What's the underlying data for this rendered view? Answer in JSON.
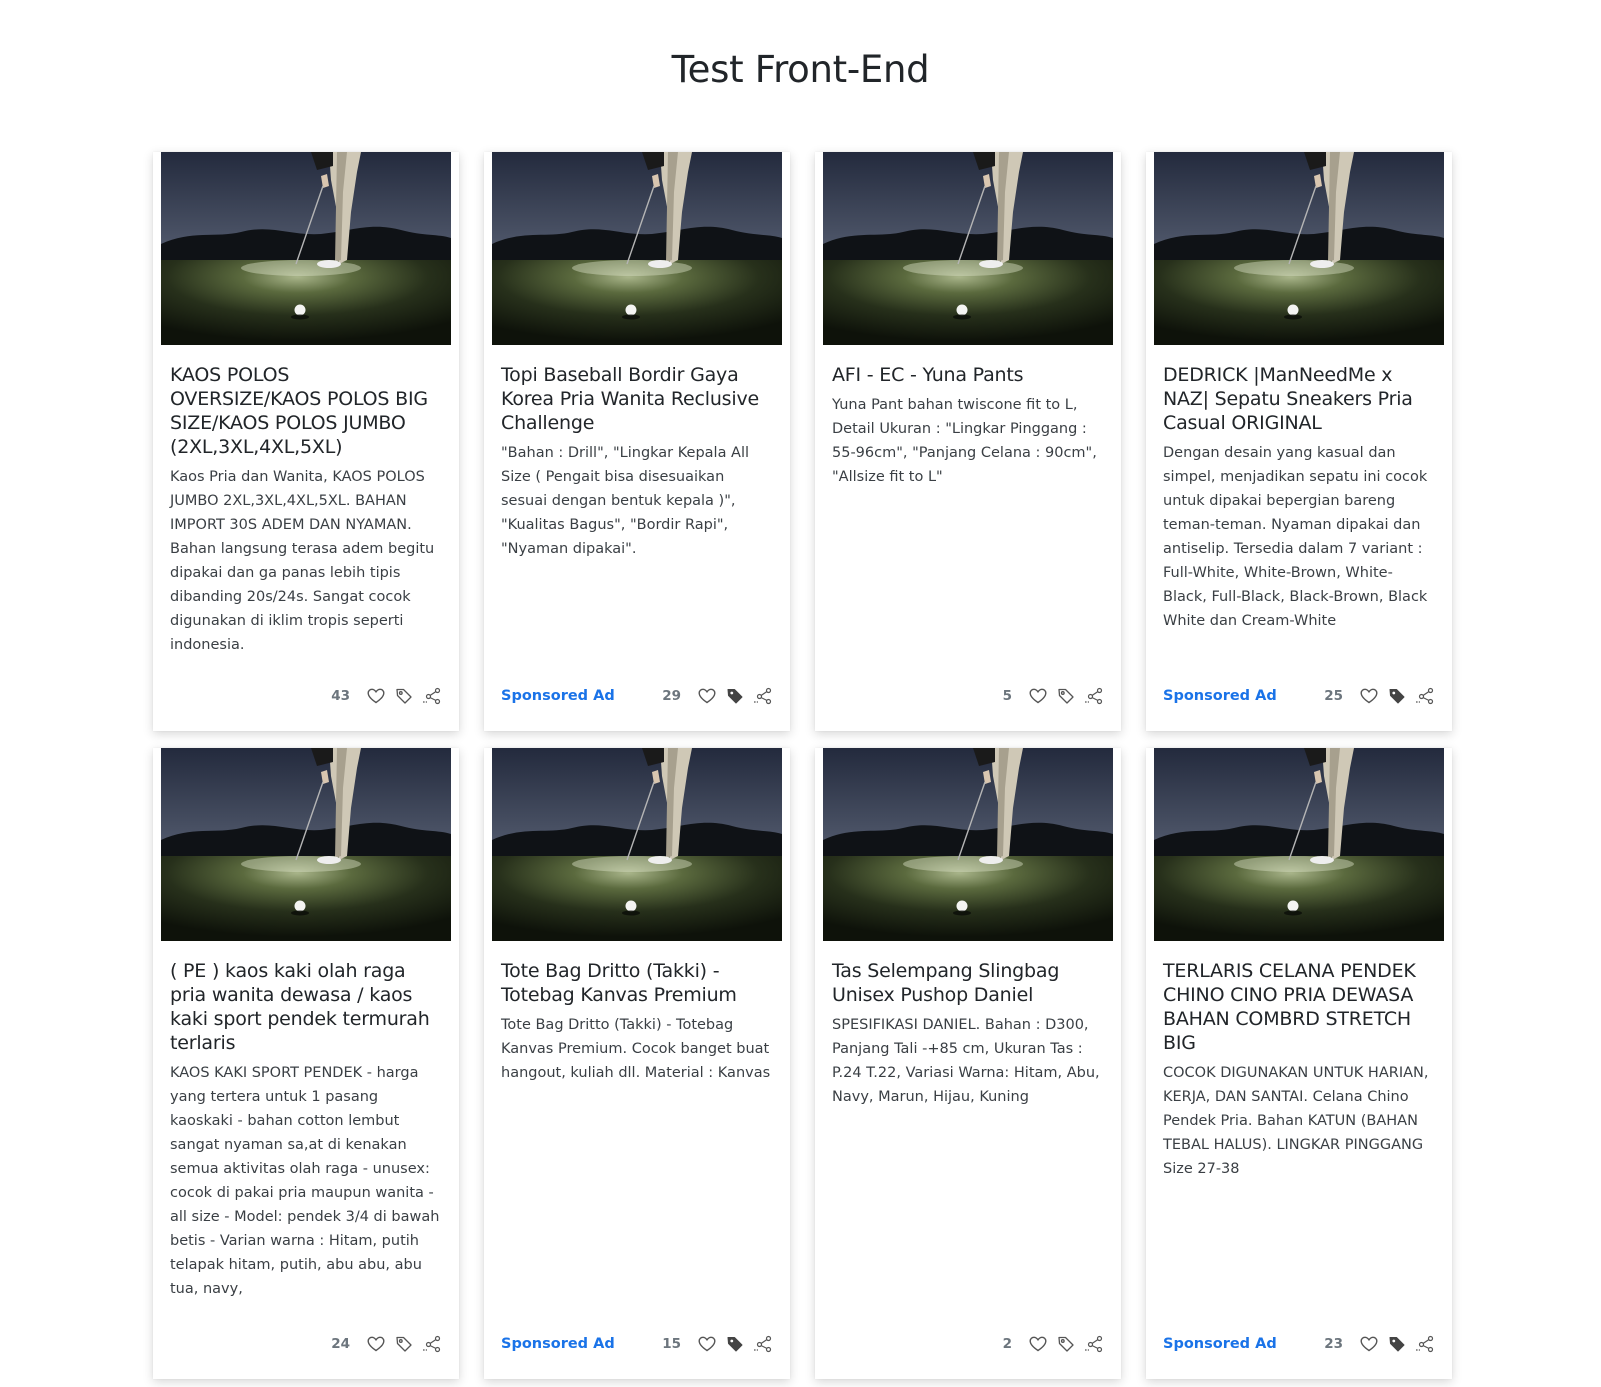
{
  "page": {
    "title": "Test Front-End"
  },
  "products": [
    {
      "title": "KAOS POLOS OVERSIZE/KAOS POLOS BIG SIZE/KAOS POLOS JUMBO (2XL,3XL,4XL,5XL)",
      "description": "Kaos Pria dan Wanita, KAOS POLOS JUMBO 2XL,3XL,4XL,5XL. BAHAN IMPORT 30S ADEM DAN NYAMAN. Bahan langsung terasa adem begitu dipakai dan ga panas lebih tipis dibanding 20s/24s. Sangat cocok digunakan di iklim tropis seperti indonesia.",
      "sponsored": "",
      "likes": "43",
      "tag_filled": false
    },
    {
      "title": "Topi Baseball Bordir Gaya Korea Pria Wanita Reclusive Challenge",
      "description": "\"Bahan : Drill\", \"Lingkar Kepala All Size ( Pengait bisa disesuaikan sesuai dengan bentuk kepala )\", \"Kualitas Bagus\", \"Bordir Rapi\", \"Nyaman dipakai\".",
      "sponsored": "Sponsored Ad",
      "likes": "29",
      "tag_filled": true
    },
    {
      "title": "AFI - EC - Yuna Pants",
      "description": "Yuna Pant bahan twiscone fit to L, Detail Ukuran : \"Lingkar Pinggang : 55-96cm\", \"Panjang Celana : 90cm\", \"Allsize fit to L\"",
      "sponsored": "",
      "likes": "5",
      "tag_filled": false
    },
    {
      "title": "DEDRICK |ManNeedMe x NAZ| Sepatu Sneakers Pria Casual ORIGINAL",
      "description": "Dengan desain yang kasual dan simpel, menjadikan sepatu ini cocok untuk dipakai bepergian bareng teman-teman. Nyaman dipakai dan antiselip. Tersedia dalam 7 variant : Full-White, White-Brown, White-Black, Full-Black, Black-Brown, Black White dan Cream-White",
      "sponsored": "Sponsored Ad",
      "likes": "25",
      "tag_filled": true
    },
    {
      "title": "( PE ) kaos kaki olah raga pria wanita dewasa / kaos kaki sport pendek termurah terlaris",
      "description": "KAOS KAKI SPORT PENDEK - harga yang tertera untuk 1 pasang kaoskaki - bahan cotton lembut sangat nyaman sa,at di kenakan semua aktivitas olah raga - unusex: cocok di pakai pria maupun wanita - all size - Model: pendek 3/4 di bawah betis - Varian warna : Hitam, putih telapak hitam, putih, abu abu, abu tua, navy,",
      "sponsored": "",
      "likes": "24",
      "tag_filled": false
    },
    {
      "title": "Tote Bag Dritto (Takki) - Totebag Kanvas Premium",
      "description": "Tote Bag Dritto (Takki) - Totebag Kanvas Premium. Cocok banget buat hangout, kuliah dll. Material : Kanvas",
      "sponsored": "Sponsored Ad",
      "likes": "15",
      "tag_filled": true
    },
    {
      "title": "Tas Selempang Slingbag Unisex Pushop Daniel",
      "description": "SPESIFIKASI DANIEL. Bahan : D300, Panjang Tali -+85 cm, Ukuran Tas : P.24 T.22, Variasi Warna: Hitam, Abu, Navy, Marun, Hijau, Kuning",
      "sponsored": "",
      "likes": "2",
      "tag_filled": false
    },
    {
      "title": "TERLARIS CELANA PENDEK CHINO CINO PRIA DEWASA BAHAN COMBRD STRETCH BIG",
      "description": "COCOK DIGUNAKAN UNTUK HARIAN, KERJA, DAN SANTAI. Celana Chino Pendek Pria. Bahan KATUN (BAHAN TEBAL HALUS). LINGKAR PINGGANG Size 27-38",
      "sponsored": "Sponsored Ad",
      "likes": "23",
      "tag_filled": true
    }
  ]
}
